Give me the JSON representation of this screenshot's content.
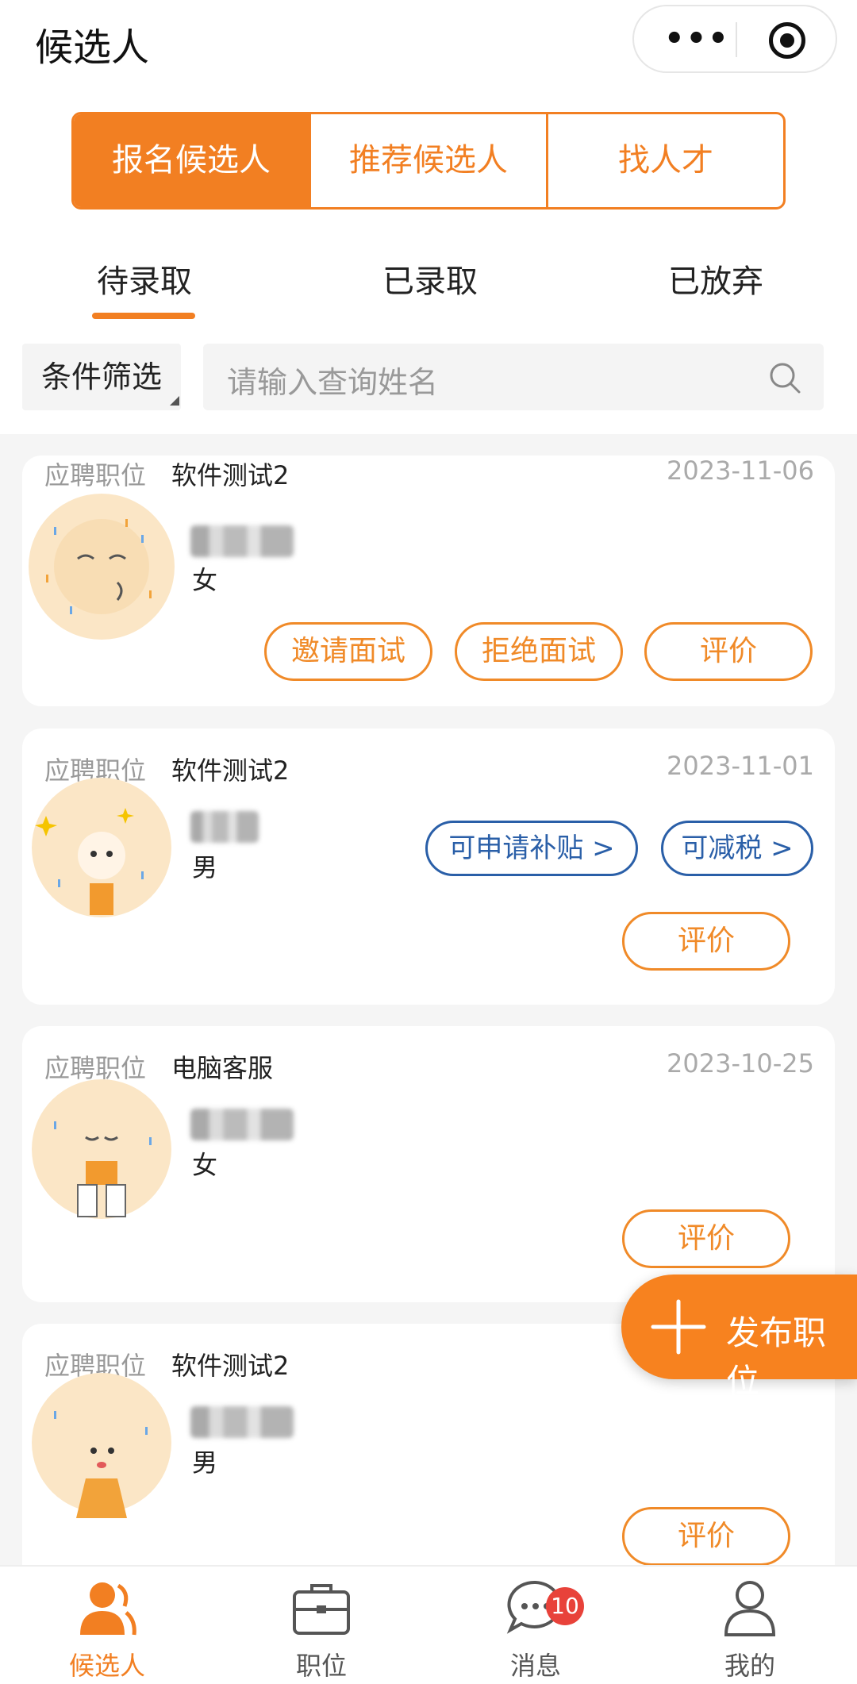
{
  "header": {
    "title": "候选人",
    "more_icon": "more-dots-icon",
    "target_icon": "target-icon"
  },
  "segments": [
    "报名候选人",
    "推荐候选人",
    "找人才"
  ],
  "tabs": [
    "待录取",
    "已录取",
    "已放弃"
  ],
  "filter": {
    "label": "条件筛选"
  },
  "search": {
    "placeholder": "请输入查询姓名",
    "icon": "search-icon"
  },
  "position_label": "应聘职位",
  "candidates": [
    {
      "position": "软件测试2",
      "date": "2023-11-06",
      "gender": "女",
      "actions": [
        "邀请面试",
        "拒绝面试",
        "评价"
      ]
    },
    {
      "position": "软件测试2",
      "date": "2023-11-01",
      "gender": "男",
      "perks": [
        "可申请补贴 >",
        "可减税 >"
      ],
      "actions": [
        "评价"
      ]
    },
    {
      "position": "电脑客服",
      "date": "2023-10-25",
      "gender": "女",
      "actions": [
        "评价"
      ]
    },
    {
      "position": "软件测试2",
      "date": "",
      "gender": "男",
      "actions": [
        "评价"
      ]
    }
  ],
  "fab": {
    "label": "发布职位",
    "icon": "plus-icon"
  },
  "tabbar": {
    "items": [
      {
        "label": "候选人",
        "icon": "person-icon"
      },
      {
        "label": "职位",
        "icon": "briefcase-icon"
      },
      {
        "label": "消息",
        "icon": "chat-icon"
      },
      {
        "label": "我的",
        "icon": "user-icon"
      }
    ],
    "badge": "10"
  },
  "colors": {
    "accent": "#f27f22",
    "perk_blue": "#2a5fa8",
    "badge_red": "#e8423a"
  }
}
